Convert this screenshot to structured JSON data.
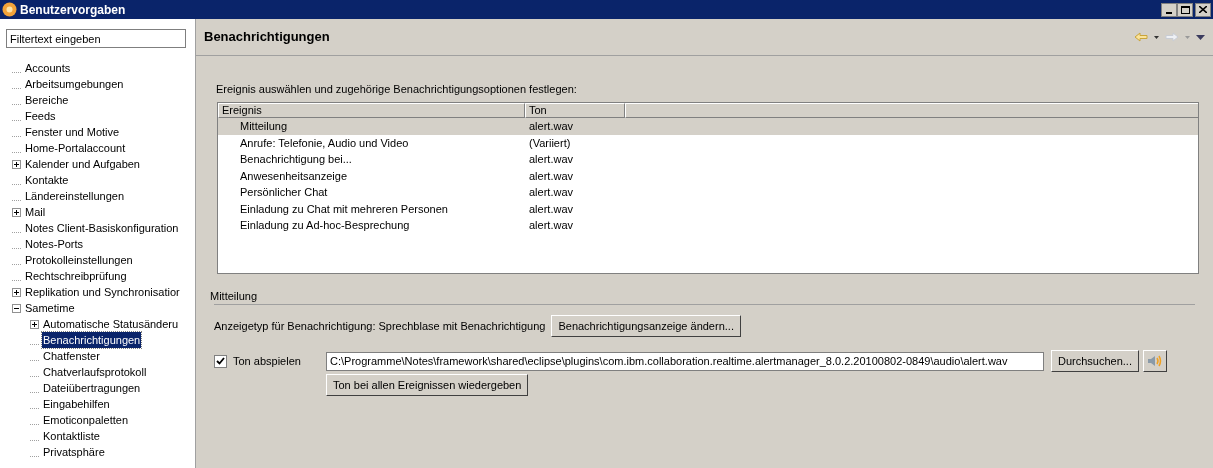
{
  "window": {
    "title": "Benutzervorgaben"
  },
  "sidebar": {
    "filter": {
      "placeholder": "Filtertext eingeben"
    },
    "items": [
      {
        "label": "Accounts",
        "selected": false
      },
      {
        "label": "Arbeitsumgebungen",
        "selected": false
      },
      {
        "label": "Bereiche",
        "selected": false
      },
      {
        "label": "Feeds",
        "selected": false
      },
      {
        "label": "Fenster und Motive",
        "selected": false
      },
      {
        "label": "Home-Portalaccount",
        "selected": false
      },
      {
        "label": "Kalender und Aufgaben",
        "selected": false,
        "expanded": false
      },
      {
        "label": "Kontakte",
        "selected": false
      },
      {
        "label": "Ländereinstellungen",
        "selected": false
      },
      {
        "label": "Mail",
        "selected": false,
        "expanded": false
      },
      {
        "label": "Notes Client-Basiskonfiguration",
        "selected": false
      },
      {
        "label": "Notes-Ports",
        "selected": false
      },
      {
        "label": "Protokolleinstellungen",
        "selected": false
      },
      {
        "label": "Rechtschreibprüfung",
        "selected": false
      },
      {
        "label": "Replikation und Synchronisatior",
        "selected": false,
        "expanded": false
      },
      {
        "label": "Sametime",
        "selected": false,
        "expanded": true,
        "children": [
          {
            "label": "Automatische Statusänderu",
            "selected": false,
            "expanded": false
          },
          {
            "label": "Benachrichtigungen",
            "selected": true
          },
          {
            "label": "Chatfenster",
            "selected": false
          },
          {
            "label": "Chatverlaufsprotokoll",
            "selected": false
          },
          {
            "label": "Dateiübertragungen",
            "selected": false
          },
          {
            "label": "Eingabehilfen",
            "selected": false
          },
          {
            "label": "Emoticonpaletten",
            "selected": false
          },
          {
            "label": "Kontaktliste",
            "selected": false
          },
          {
            "label": "Privatsphäre",
            "selected": false
          }
        ]
      }
    ]
  },
  "page": {
    "title": "Benachrichtigungen",
    "description": "Ereignis auswählen und zugehörige Benachrichtigungsoptionen festlegen:",
    "table": {
      "columns": [
        "Ereignis",
        "Ton"
      ],
      "rows": [
        {
          "cells": [
            "Mitteilung",
            "alert.wav"
          ],
          "selected": true
        },
        {
          "cells": [
            "Anrufe: Telefonie, Audio und Video",
            "(Variiert)"
          ],
          "selected": false
        },
        {
          "cells": [
            "Benachrichtigung bei...",
            "alert.wav"
          ],
          "selected": false
        },
        {
          "cells": [
            "Anwesenheitsanzeige",
            "alert.wav"
          ],
          "selected": false
        },
        {
          "cells": [
            "Persönlicher Chat",
            "alert.wav"
          ],
          "selected": false
        },
        {
          "cells": [
            "Einladung zu Chat mit mehreren Personen",
            "alert.wav"
          ],
          "selected": false
        },
        {
          "cells": [
            "Einladung zu Ad-hoc-Besprechung",
            "alert.wav"
          ],
          "selected": false
        }
      ]
    },
    "group": {
      "title": "Mitteilung",
      "display_type": "Anzeigetyp für Benachrichtigung: Sprechblase mit Benachrichtigung",
      "change_button": "Benachrichtigungsanzeige ändern...",
      "play_sound": {
        "label": "Ton abspielen",
        "checked": true
      },
      "sound_path": "C:\\Programme\\Notes\\framework\\shared\\eclipse\\plugins\\com.ibm.collaboration.realtime.alertmanager_8.0.2.20100802-0849\\audio\\alert.wav",
      "browse_button": "Durchsuchen...",
      "play_all_button": "Ton bei allen Ereignissen wiedergeben"
    }
  }
}
